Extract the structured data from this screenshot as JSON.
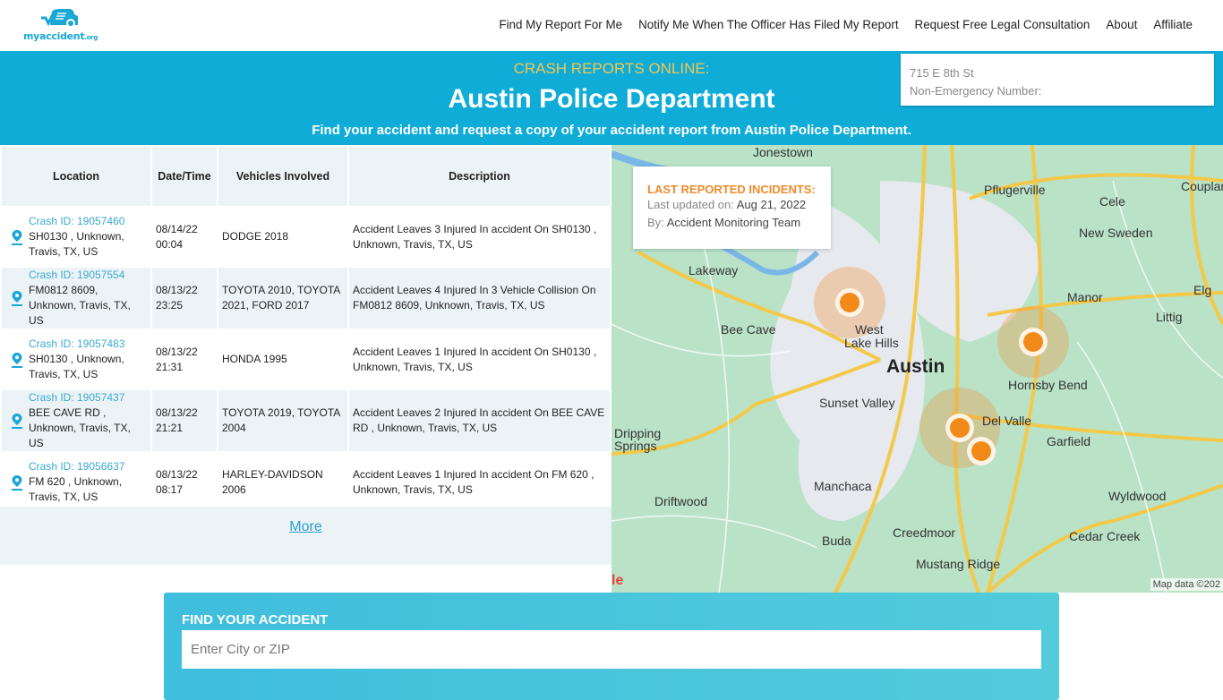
{
  "brand": {
    "logo_text": "myaccident",
    "logo_suffix": ".org"
  },
  "nav": {
    "items": [
      {
        "label": "Find My Report For Me"
      },
      {
        "label": "Notify Me When The Officer Has Filed My Report"
      },
      {
        "label": "Request Free Legal Consultation"
      },
      {
        "label": "About"
      },
      {
        "label": "Affiliate"
      }
    ]
  },
  "hero": {
    "kicker": "CRASH REPORTS ONLINE:",
    "title": "Austin Police Department",
    "subtitle": "Find your accident and request a copy of your accident report from Austin Police Department."
  },
  "address_card": {
    "address": "715 E 8th St",
    "phone_label": "Non-Emergency Number:"
  },
  "table": {
    "headers": [
      "Location",
      "Date/Time",
      "Vehicles Involved",
      "Description"
    ],
    "rows": [
      {
        "crash_id": "Crash ID: 19057460",
        "location": "SH0130 , Unknown, Travis, TX, US",
        "date": "08/14/22",
        "time": "00:04",
        "vehicles": "DODGE 2018",
        "description": "Accident Leaves 3 Injured In accident On SH0130 , Unknown, Travis, TX, US"
      },
      {
        "crash_id": "Crash ID: 19057554",
        "location": "FM0812 8609, Unknown, Travis, TX, US",
        "date": "08/13/22",
        "time": "23:25",
        "vehicles": "TOYOTA 2010, TOYOTA 2021, FORD 2017",
        "description": "Accident Leaves 4 Injured In 3 Vehicle Collision On FM0812 8609, Unknown, Travis, TX, US"
      },
      {
        "crash_id": "Crash ID: 19057483",
        "location": "SH0130 , Unknown, Travis, TX, US",
        "date": "08/13/22",
        "time": "21:31",
        "vehicles": "HONDA 1995",
        "description": "Accident Leaves 1 Injured In accident On SH0130 , Unknown, Travis, TX, US"
      },
      {
        "crash_id": "Crash ID: 19057437",
        "location": "BEE CAVE RD , Unknown, Travis, TX, US",
        "date": "08/13/22",
        "time": "21:21",
        "vehicles": "TOYOTA 2019, TOYOTA 2004",
        "description": "Accident Leaves 2 Injured In accident On BEE CAVE RD , Unknown, Travis, TX, US"
      },
      {
        "crash_id": "Crash ID: 19056637",
        "location": "FM 620 , Unknown, Travis, TX, US",
        "date": "08/13/22",
        "time": "08:17",
        "vehicles": "HARLEY-DAVIDSON 2006",
        "description": "Accident Leaves 1 Injured In accident On FM 620 , Unknown, Travis, TX, US"
      }
    ],
    "more_label": "More"
  },
  "map": {
    "info": {
      "title": "LAST REPORTED INCIDENTS:",
      "updated_label": "Last updated on:",
      "updated_value": "Aug 21, 2022",
      "by_label": "By:",
      "by_value": "Accident Monitoring Team"
    },
    "places": [
      "Jonestown",
      "Pflugerville",
      "Cele",
      "Couplan",
      "New Sweden",
      "Lakeway",
      "Manor",
      "Elg",
      "Littig",
      "Bee Cave",
      "West",
      "Lake Hills",
      "Austin",
      "Hornsby Bend",
      "Sunset Valley",
      "Del Valle",
      "Dripping",
      "Springs",
      "Garfield",
      "Manchaca",
      "Driftwood",
      "Wyldwood",
      "Buda",
      "Creedmoor",
      "Cedar Creek",
      "Mustang Ridge"
    ],
    "attribution": "Map data ©202",
    "google_fragment": "le"
  },
  "find": {
    "title": "FIND YOUR ACCIDENT",
    "placeholder": "Enter City or ZIP"
  },
  "colors": {
    "brand": "#10acd8",
    "accent_orange": "#f08a2a",
    "kicker_yellow": "#f4c64c"
  }
}
